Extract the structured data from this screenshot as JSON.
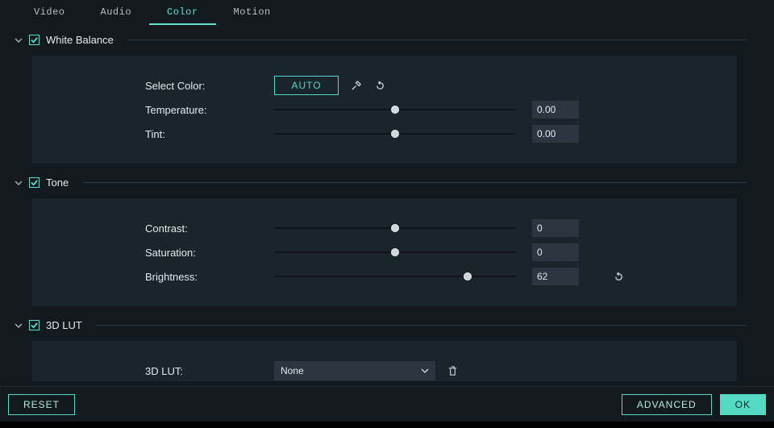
{
  "tabs": {
    "video": "Video",
    "audio": "Audio",
    "color": "Color",
    "motion": "Motion",
    "active": "color"
  },
  "sections": {
    "whiteBalance": {
      "title": "White Balance",
      "checked": true,
      "selectColorLabel": "Select Color:",
      "autoLabel": "AUTO",
      "temperatureLabel": "Temperature:",
      "temperatureValue": "0.00",
      "temperaturePos": 50,
      "tintLabel": "Tint:",
      "tintValue": "0.00",
      "tintPos": 50
    },
    "tone": {
      "title": "Tone",
      "checked": true,
      "contrastLabel": "Contrast:",
      "contrastValue": "0",
      "contrastPos": 50,
      "saturationLabel": "Saturation:",
      "saturationValue": "0",
      "saturationPos": 50,
      "brightnessLabel": "Brightness:",
      "brightnessValue": "62",
      "brightnessPos": 80
    },
    "lut": {
      "title": "3D LUT",
      "checked": true,
      "label": "3D LUT:",
      "selected": "None"
    }
  },
  "footer": {
    "reset": "RESET",
    "advanced": "ADVANCED",
    "ok": "OK"
  }
}
